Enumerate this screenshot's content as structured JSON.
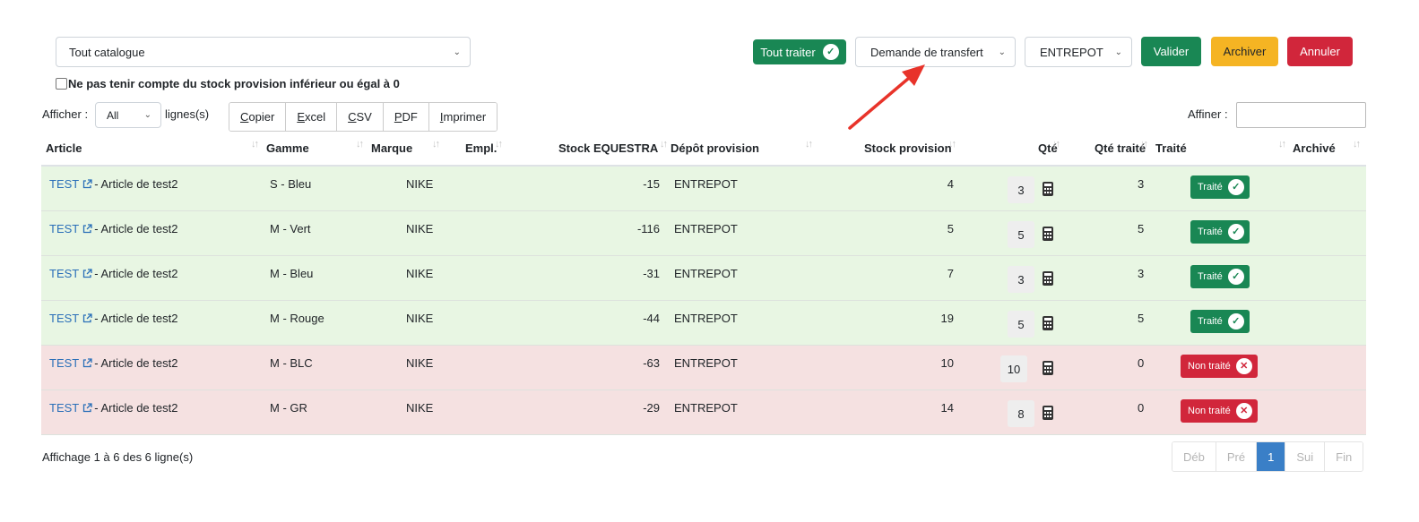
{
  "top": {
    "catalogue_select": "Tout catalogue",
    "tout_traiter_label": "Tout traiter",
    "transfer_select": "Demande de transfert",
    "depot_select": "ENTREPOT",
    "valider_label": "Valider",
    "archiver_label": "Archiver",
    "annuler_label": "Annuler",
    "checkbox_label": "Ne pas tenir compte du stock provision inférieur ou égal à 0"
  },
  "controls": {
    "afficher_label": "Afficher :",
    "lines_select": "All",
    "lines_suffix": "lignes(s)",
    "export_buttons": [
      {
        "first": "C",
        "rest": "opier"
      },
      {
        "first": "E",
        "rest": "xcel"
      },
      {
        "first": "C",
        "rest": "SV"
      },
      {
        "first": "P",
        "rest": "DF"
      },
      {
        "first": "I",
        "rest": "mprimer"
      }
    ],
    "search_label": "Affiner :"
  },
  "table": {
    "headers": {
      "article": "Article",
      "gamme": "Gamme",
      "marque": "Marque",
      "empl": "Empl.",
      "stock_equestra": "Stock EQUESTRA",
      "depot": "Dépôt provision",
      "stock_provision": "Stock provision",
      "qte": "Qté",
      "qte_traite": "Qté traité",
      "traite": "Traité",
      "archive": "Archivé"
    },
    "rows": [
      {
        "code": "TEST",
        "article": "- Article de test2",
        "gamme": "S - Bleu",
        "marque": "NIKE",
        "stock": "-15",
        "depot": "ENTREPOT",
        "provision": "4",
        "qte": "3",
        "qte_traite": "3",
        "status": "Traité"
      },
      {
        "code": "TEST",
        "article": "- Article de test2",
        "gamme": "M - Vert",
        "marque": "NIKE",
        "stock": "-116",
        "depot": "ENTREPOT",
        "provision": "5",
        "qte": "5",
        "qte_traite": "5",
        "status": "Traité"
      },
      {
        "code": "TEST",
        "article": "- Article de test2",
        "gamme": "M - Bleu",
        "marque": "NIKE",
        "stock": "-31",
        "depot": "ENTREPOT",
        "provision": "7",
        "qte": "3",
        "qte_traite": "3",
        "status": "Traité"
      },
      {
        "code": "TEST",
        "article": "- Article de test2",
        "gamme": "M - Rouge",
        "marque": "NIKE",
        "stock": "-44",
        "depot": "ENTREPOT",
        "provision": "19",
        "qte": "5",
        "qte_traite": "5",
        "status": "Traité"
      },
      {
        "code": "TEST",
        "article": "- Article de test2",
        "gamme": "M - BLC",
        "marque": "NIKE",
        "stock": "-63",
        "depot": "ENTREPOT",
        "provision": "10",
        "qte": "10",
        "qte_traite": "0",
        "status": "Non traité"
      },
      {
        "code": "TEST",
        "article": "- Article de test2",
        "gamme": "M - GR",
        "marque": "NIKE",
        "stock": "-29",
        "depot": "ENTREPOT",
        "provision": "14",
        "qte": "8",
        "qte_traite": "0",
        "status": "Non traité"
      }
    ]
  },
  "footer": {
    "info": "Affichage 1 à 6 des 6 ligne(s)",
    "pager": [
      "Déb",
      "Pré",
      "1",
      "Sui",
      "Fin"
    ]
  },
  "colors": {
    "success": "#198754",
    "danger": "#d1263b",
    "warning": "#f5b423",
    "row_ok": "#e8f6e3",
    "row_ko": "#f5e1e1",
    "link": "#2a6fb8",
    "annotation_arrow": "#e8332a"
  }
}
